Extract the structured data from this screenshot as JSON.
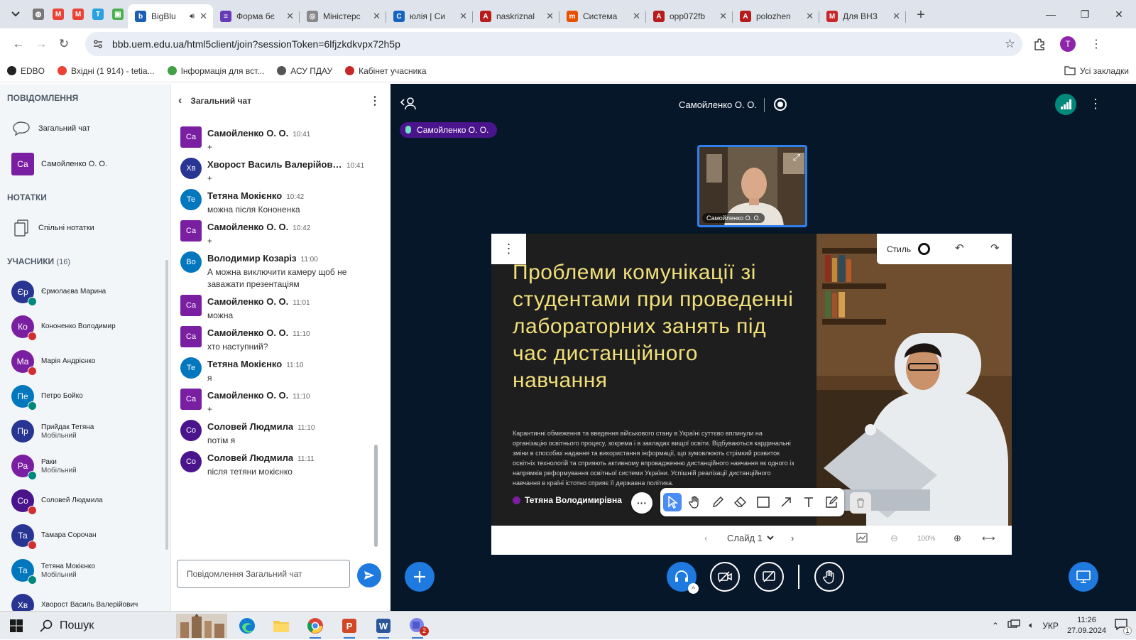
{
  "browser": {
    "tabs": [
      {
        "title": "BigBlu",
        "active": true,
        "favicon_color": "#1a5fb4",
        "favicon_letter": "b"
      },
      {
        "title": "Форма бє",
        "active": false,
        "favicon_color": "#673ab7",
        "favicon_letter": "≡"
      },
      {
        "title": "Міністерс",
        "active": false,
        "favicon_color": "#888888",
        "favicon_letter": "◎"
      },
      {
        "title": "юлія | Си",
        "active": false,
        "favicon_color": "#1565c0",
        "favicon_letter": "C"
      },
      {
        "title": "naskriznal",
        "active": false,
        "favicon_color": "#b71c1c",
        "favicon_letter": "A"
      },
      {
        "title": "Система",
        "active": false,
        "favicon_color": "#e65100",
        "favicon_letter": "m"
      },
      {
        "title": "opp072fb",
        "active": false,
        "favicon_color": "#b71c1c",
        "favicon_letter": "A"
      },
      {
        "title": "polozhen",
        "active": false,
        "favicon_color": "#b71c1c",
        "favicon_letter": "A"
      },
      {
        "title": "Для ВНЗ",
        "active": false,
        "favicon_color": "#c62828",
        "favicon_letter": "M"
      }
    ],
    "pinned_tabs": [
      {
        "icon": "globe-icon",
        "color": "#777777",
        "letter": "◍"
      },
      {
        "icon": "gmail-icon",
        "color": "#ea4335",
        "letter": "M"
      },
      {
        "icon": "gmail-icon",
        "color": "#ea4335",
        "letter": "M"
      },
      {
        "icon": "telegram-icon",
        "color": "#2aa1e0",
        "letter": "T"
      },
      {
        "icon": "maps-icon",
        "color": "#4caf50",
        "letter": "▣"
      }
    ],
    "url": "bbb.uem.edu.ua/html5client/join?sessionToken=6lfjzkdkvpx72h5p",
    "profile_letter": "T",
    "bookmarks": [
      {
        "label": "EDBO",
        "icon": "edbo-icon",
        "color": "#222222"
      },
      {
        "label": "Вхідні (1 914) - tetia...",
        "icon": "gmail-icon",
        "color": "#ea4335"
      },
      {
        "label": "Інформація для вст...",
        "icon": "info-icon",
        "color": "#43a047"
      },
      {
        "label": "АСУ ПДАУ",
        "icon": "globe-icon",
        "color": "#555555"
      },
      {
        "label": "Кабінет учасника",
        "icon": "cabinet-icon",
        "color": "#c62828"
      }
    ],
    "all_bookmarks": "Усі закладки"
  },
  "sidebar": {
    "messages_title": "ПОВІДОМЛЕННЯ",
    "public_chat": "Загальний чат",
    "private_chat": {
      "initials": "Са",
      "name": "Самойленко О. О."
    },
    "notes_title": "НОТАТКИ",
    "shared_notes": "Спільні нотатки",
    "participants_title": "УЧАСНИКИ",
    "participants_count": "(16)",
    "participants": [
      {
        "initials": "Єр",
        "name": "Єрмолаєва Марина",
        "sub": "",
        "color": "#283593",
        "status": "mic"
      },
      {
        "initials": "Ко",
        "name": "Кононенко Володимир",
        "sub": "",
        "color": "#7b1fa2",
        "status": "muted"
      },
      {
        "initials": "Ма",
        "name": "Марія Андрієнко",
        "sub": "",
        "color": "#7b1fa2",
        "status": "muted"
      },
      {
        "initials": "Пе",
        "name": "Петро Бойко",
        "sub": "",
        "color": "#0277bd",
        "status": "mic"
      },
      {
        "initials": "Пр",
        "name": "Прийдак Тетяна",
        "sub": "Мобільний",
        "color": "#283593",
        "status": "none"
      },
      {
        "initials": "Ра",
        "name": "Раки",
        "sub": "Мобільний",
        "color": "#7b1fa2",
        "status": "mic"
      },
      {
        "initials": "Со",
        "name": "Соловей Людмила",
        "sub": "",
        "color": "#4a148c",
        "status": "muted"
      },
      {
        "initials": "Та",
        "name": "Тамара Сорочан",
        "sub": "",
        "color": "#283593",
        "status": "muted"
      },
      {
        "initials": "Та",
        "name": "Тетяна Мокієнко",
        "sub": "Мобільний",
        "color": "#0277bd",
        "status": "mic"
      },
      {
        "initials": "Хв",
        "name": "Хворост Василь Валерійович",
        "sub": "",
        "color": "#283593",
        "status": "muted"
      }
    ]
  },
  "chat": {
    "title": "Загальний чат",
    "input_placeholder": "Повідомлення Загальний чат",
    "messages": [
      {
        "initials": "Са",
        "name": "Самойленко О. О.",
        "time": "10:41",
        "text": "+",
        "color": "#7b1fa2",
        "square": true
      },
      {
        "initials": "Хв",
        "name": "Хворост Василь Валерійович",
        "time": "10:41",
        "text": "+",
        "color": "#283593",
        "square": false
      },
      {
        "initials": "Те",
        "name": "Тетяна Мокієнко",
        "time": "10:42",
        "text": "можна після Кононенка",
        "color": "#0277bd",
        "square": false
      },
      {
        "initials": "Са",
        "name": "Самойленко О. О.",
        "time": "10:42",
        "text": "+",
        "color": "#7b1fa2",
        "square": true
      },
      {
        "initials": "Во",
        "name": "Володимир Козаріз",
        "time": "11:00",
        "text": "А можна виключити камеру щоб не заважати презентаціям",
        "color": "#0277bd",
        "square": false
      },
      {
        "initials": "Са",
        "name": "Самойленко О. О.",
        "time": "11:01",
        "text": "можна",
        "color": "#7b1fa2",
        "square": true
      },
      {
        "initials": "Са",
        "name": "Самойленко О. О.",
        "time": "11:10",
        "text": "хто наступний?",
        "color": "#7b1fa2",
        "square": true
      },
      {
        "initials": "Те",
        "name": "Тетяна Мокієнко",
        "time": "11:10",
        "text": "я",
        "color": "#0277bd",
        "square": false
      },
      {
        "initials": "Са",
        "name": "Самойленко О. О.",
        "time": "11:10",
        "text": "+",
        "color": "#7b1fa2",
        "square": true
      },
      {
        "initials": "Со",
        "name": "Соловей Людмила",
        "time": "11:10",
        "text": "потім я",
        "color": "#4a148c",
        "square": false
      },
      {
        "initials": "Со",
        "name": "Соловей Людмила",
        "time": "11:11",
        "text": "після тетяни мокієнко",
        "color": "#4a148c",
        "square": false
      }
    ]
  },
  "stage": {
    "presenter": "Самойленко О. О.",
    "talking": "Самойленко О. О.",
    "webcam_label": "Самойленко О. О.",
    "slide": {
      "title": "Проблеми комунікації зі студентами при проведенні лабораторних занять під час дистанційного навчання",
      "body": "Карантинні обмеження та введення військового стану в Україні суттєво вплинули на організацію освітнього процесу, зокрема і в закладах вищої освіти. Відбуваються кардинальні зміни в способах надання та використання інформації, що зумовлюють стрімкий розвиток освітніх технологій та сприяють активному впровадженню дистанційного навчання як одного із напрямків реформування освітньої системи України. Успішній реалізації дистанційного навчання в країні істотно сприяє її державна політика.",
      "author": "Тетяна Володимирівна",
      "author_initial": "T"
    },
    "style_label": "Стиль",
    "slide_label": "Слайд 1",
    "zoom": "100%"
  },
  "taskbar": {
    "search": "Пошук",
    "lang": "УКР",
    "time": "11:26",
    "date": "27.09.2024",
    "notif_count": "1",
    "teams_badge": "2"
  },
  "colors": {
    "bbb_blue": "#1f7ae0",
    "stage_bg": "#06172a",
    "slide_title": "#f1e07a"
  }
}
